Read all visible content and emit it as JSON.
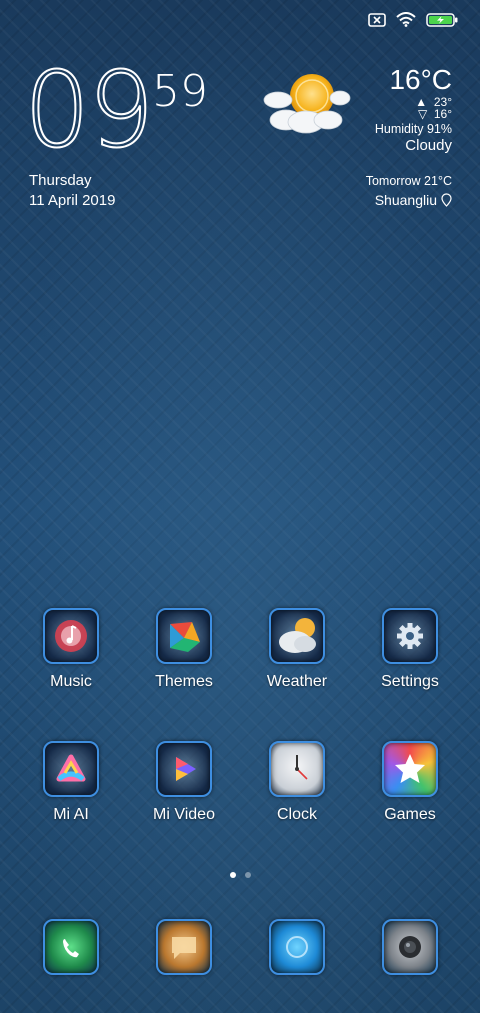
{
  "status_bar": {
    "icons": [
      "no-sim-icon",
      "wifi-icon",
      "battery-charging-icon"
    ]
  },
  "clock": {
    "hours": "09",
    "minutes": "59"
  },
  "date": {
    "day": "Thursday",
    "full": "11 April 2019"
  },
  "weather": {
    "icon": "partly-cloudy-icon",
    "temperature": "16°C",
    "high": "23°",
    "low": "16°",
    "humidity": "Humidity 91%",
    "condition": "Cloudy",
    "tomorrow": "Tomorrow 21°C",
    "location": "Shuangliu"
  },
  "apps_row1": [
    {
      "label": "Music",
      "icon": "music-icon"
    },
    {
      "label": "Themes",
      "icon": "themes-icon"
    },
    {
      "label": "Weather",
      "icon": "weather-icon"
    },
    {
      "label": "Settings",
      "icon": "gear-icon"
    }
  ],
  "apps_row2": [
    {
      "label": "Mi AI",
      "icon": "mi-ai-icon"
    },
    {
      "label": "Mi Video",
      "icon": "play-icon"
    },
    {
      "label": "Clock",
      "icon": "clock-icon"
    },
    {
      "label": "Games",
      "icon": "star-icon"
    }
  ],
  "dock": [
    {
      "icon": "phone-icon"
    },
    {
      "icon": "message-icon"
    },
    {
      "icon": "browser-icon"
    },
    {
      "icon": "camera-icon"
    }
  ],
  "pager": {
    "pages": 2,
    "active_index": 0
  },
  "colors": {
    "tile_border": "#3e8ee0",
    "background": "#1f4466"
  }
}
